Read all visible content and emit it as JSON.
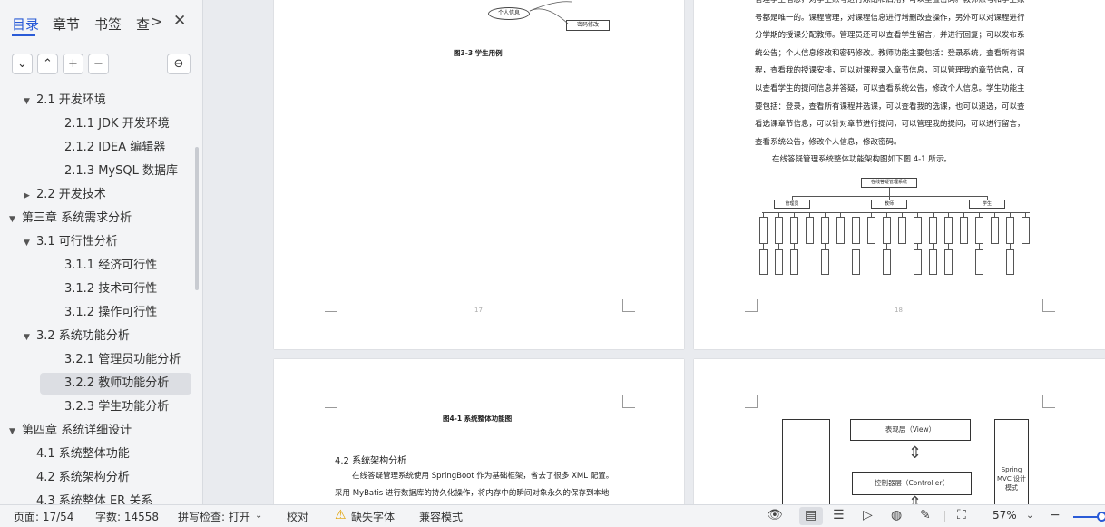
{
  "nav": {
    "tabs": [
      "目录",
      "章节",
      "书签",
      "查"
    ],
    "more_icon": ">",
    "close_icon": "✕",
    "tools": {
      "expand": "⌄",
      "collapse": "⌃",
      "add": "+",
      "remove": "−",
      "collapse_all": "⊖"
    }
  },
  "toc": [
    {
      "text": "2.1  开发环境",
      "level": 2,
      "toggle": "open"
    },
    {
      "text": "2.1.1 JDK 开发环境",
      "level": 3
    },
    {
      "text": "2.1.2 IDEA 编辑器",
      "level": 3
    },
    {
      "text": "2.1.3 MySQL 数据库",
      "level": 3
    },
    {
      "text": "2.2  开发技术",
      "level": 2,
      "toggle": "closed"
    },
    {
      "text": "第三章  系统需求分析",
      "level": 1,
      "toggle": "open"
    },
    {
      "text": "3.1  可行性分析",
      "level": 2,
      "toggle": "open"
    },
    {
      "text": "3.1.1  经济可行性",
      "level": 3
    },
    {
      "text": "3.1.2  技术可行性",
      "level": 3
    },
    {
      "text": "3.1.2  操作可行性",
      "level": 3
    },
    {
      "text": "3.2  系统功能分析",
      "level": 2,
      "toggle": "open"
    },
    {
      "text": "3.2.1  管理员功能分析",
      "level": 3
    },
    {
      "text": "3.2.2  教师功能分析",
      "level": 3,
      "selected": true
    },
    {
      "text": "3.2.3  学生功能分析",
      "level": 3
    },
    {
      "text": "第四章  系统详细设计",
      "level": 1,
      "toggle": "open"
    },
    {
      "text": "4.1  系统整体功能",
      "level": 2
    },
    {
      "text": "4.2  系统架构分析",
      "level": 2
    },
    {
      "text": "4.3  系统整体 ER 关系",
      "level": 2
    }
  ],
  "pages": {
    "p17": {
      "caption": "图3-3  学生用例",
      "node_personal": "个人信息",
      "node_pwd": "密码修改",
      "number": "17"
    },
    "p18": {
      "lines": [
        "管理学生信息，对学生账号进行冻结和启用，可以重置密码。教师账号和学生账",
        "号都是唯一的。课程管理，对课程信息进行增删改查操作，另外可以对课程进行",
        "分学期的授课分配教师。管理员还可以查看学生留言，并进行回复；可以发布系",
        "统公告；个人信息修改和密码修改。教师功能主要包括：登录系统，查看所有课",
        "程，查看我的授课安排，可以对课程录入章节信息，可以管理我的章节信息，可",
        "以查看学生的提问信息并答疑，可以查看系统公告，修改个人信息。学生功能主",
        "要包括：登录，查看所有课程并选课，可以查看我的选课，也可以退选，可以查",
        "看选课章节信息，可以针对章节进行提问，可以管理我的提问，可以进行留言，",
        "查看系统公告，修改个人信息，修改密码。"
      ],
      "intro": "在线答疑管理系统整体功能架构图如下图 4-1 所示。",
      "diagram_root": "在线答疑管理系统",
      "diagram_roles": [
        "管理员",
        "教师",
        "学生"
      ],
      "number": "18"
    },
    "p19": {
      "caption": "图4-1  系统整体功能图",
      "heading": "4.2  系统架构分析",
      "line1": "在线答疑管理系统使用 SpringBoot 作为基础框架，省去了很多 XML 配置。",
      "line2": "采用 MyBatis 进行数据库的持久化操作，将内存中的瞬间对象永久的保存到本地"
    },
    "p20": {
      "view_layer": "表现层（View）",
      "controller_layer": "控制器层（Controller）",
      "side_label": "Spring MVC 设计模式"
    }
  },
  "status": {
    "page": "页面: 17/54",
    "words": "字数: 14558",
    "spell": "拼写检查: 打开",
    "proof": "校对",
    "missing_font": "缺失字体",
    "compat": "兼容模式",
    "zoom": "57%"
  }
}
